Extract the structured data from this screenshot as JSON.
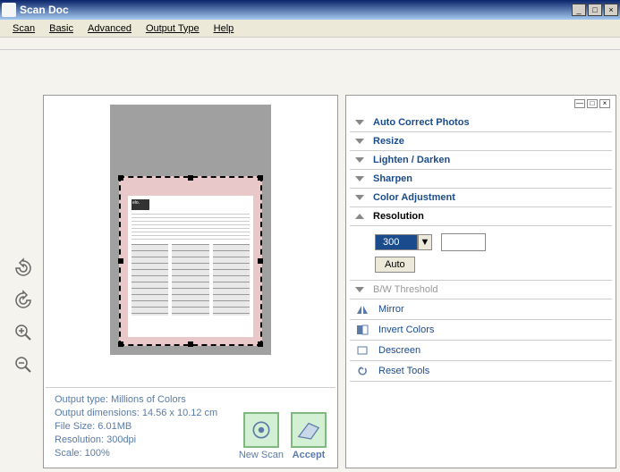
{
  "window": {
    "title": "Scan Doc"
  },
  "menu": {
    "scan": "Scan",
    "basic": "Basic",
    "advanced": "Advanced",
    "output_type": "Output Type",
    "help": "Help"
  },
  "tools": {
    "rotate_ccw": "rotate-ccw",
    "rotate_cw": "rotate-cw",
    "zoom_in": "zoom-in",
    "zoom_out": "zoom-out"
  },
  "preview": {
    "doc_logo": "elo."
  },
  "info": {
    "output_type": "Output type: Millions of Colors",
    "dimensions": "Output dimensions: 14.56 x 10.12 cm",
    "file_size": "File Size: 6.01MB",
    "resolution": "Resolution:  300dpi",
    "scale": "Scale: 100%"
  },
  "actions": {
    "new_scan": "New Scan",
    "accept": "Accept"
  },
  "settings": {
    "auto_correct": "Auto Correct Photos",
    "resize": "Resize",
    "lighten_darken": "Lighten / Darken",
    "sharpen": "Sharpen",
    "color_adjustment": "Color Adjustment",
    "resolution": "Resolution",
    "resolution_value": "300",
    "auto": "Auto",
    "bw_threshold": "B/W Threshold",
    "mirror": "Mirror",
    "invert_colors": "Invert Colors",
    "descreen": "Descreen",
    "reset_tools": "Reset Tools"
  }
}
